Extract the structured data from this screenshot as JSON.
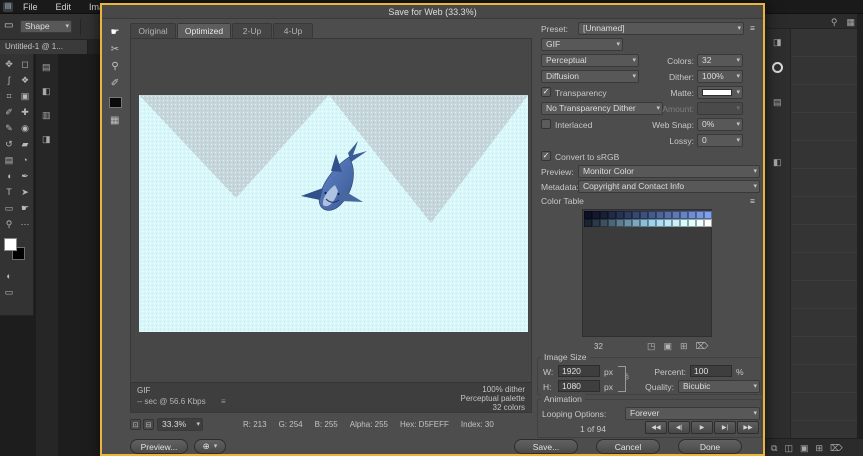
{
  "icons": {
    "chevron_down": "▾",
    "hamburger": "≡",
    "check": "✓",
    "search": "⚲",
    "grid": "▦",
    "globe": "⊕",
    "menu_small": "≡",
    "link": "§",
    "logo": "▤",
    "shape_tool": "▭"
  },
  "menu": {
    "items": [
      {
        "name": "menu-file",
        "label": "File"
      },
      {
        "name": "menu-edit",
        "label": "Edit"
      },
      {
        "name": "menu-image",
        "label": "Image"
      }
    ]
  },
  "workspace": {
    "options_bar": {
      "shape_label": "Shape"
    },
    "doc_tab": "Untitled-1 @ 1...",
    "toolbar_tools": [
      {
        "name": "move-tool",
        "glyph": "✥"
      },
      {
        "name": "marquee-tool",
        "glyph": "◻"
      },
      {
        "name": "lasso-tool",
        "glyph": "ʃ"
      },
      {
        "name": "quick-selection-tool",
        "glyph": "❖"
      },
      {
        "name": "crop-tool",
        "glyph": "⌗"
      },
      {
        "name": "frame-tool",
        "glyph": "▣"
      },
      {
        "name": "eyedropper-tool",
        "glyph": "✐"
      },
      {
        "name": "healing-brush-tool",
        "glyph": "✚"
      },
      {
        "name": "brush-tool",
        "glyph": "✎"
      },
      {
        "name": "clone-stamp-tool",
        "glyph": "◉"
      },
      {
        "name": "history-brush-tool",
        "glyph": "↺"
      },
      {
        "name": "eraser-tool",
        "glyph": "▰"
      },
      {
        "name": "gradient-tool",
        "glyph": "▤"
      },
      {
        "name": "blur-tool",
        "glyph": "◔"
      },
      {
        "name": "dodge-tool",
        "glyph": "◖"
      },
      {
        "name": "pen-tool",
        "glyph": "✒"
      },
      {
        "name": "type-tool",
        "glyph": "T"
      },
      {
        "name": "path-selection-tool",
        "glyph": "➤"
      },
      {
        "name": "rectangle-tool",
        "glyph": "▭"
      },
      {
        "name": "hand-tool",
        "glyph": "☛"
      },
      {
        "name": "zoom-tool",
        "glyph": "⚲"
      },
      {
        "name": "edit-toolbar-button",
        "glyph": "⋯"
      }
    ],
    "below_swatch_icons": [
      {
        "name": "quick-mask-icon",
        "glyph": "◐"
      },
      {
        "name": "screen-mode-icon",
        "glyph": "▭"
      }
    ],
    "left_dock_icons": [
      {
        "name": "dock-panel-icon-1",
        "glyph": "▤"
      },
      {
        "name": "dock-panel-icon-2",
        "glyph": "◧"
      },
      {
        "name": "dock-panel-icon-3",
        "glyph": "▥"
      },
      {
        "name": "dock-panel-icon-4",
        "glyph": "◨"
      }
    ],
    "right_dock": {
      "top_icons": [
        {
          "name": "search-icon",
          "glyph": "⚲"
        },
        {
          "name": "workspace-switcher-icon",
          "glyph": "▦"
        }
      ],
      "column_icons": [
        {
          "name": "panel-icon-color",
          "glyph": "◨"
        },
        {
          "name": "panel-icon-swatches",
          "glyph": "▤"
        },
        {
          "name": "panel-icon-adjustments",
          "glyph": "◧"
        }
      ],
      "bottom_icons": [
        {
          "name": "link-layers-icon",
          "glyph": "⧉"
        },
        {
          "name": "layer-style-icon",
          "glyph": "◫"
        },
        {
          "name": "add-mask-icon",
          "glyph": "▣"
        },
        {
          "name": "new-layer-icon",
          "glyph": "⊞"
        },
        {
          "name": "delete-layer-icon",
          "glyph": "⌦"
        }
      ]
    }
  },
  "dialog": {
    "title": "Save for Web (33.3%)",
    "tabs": [
      {
        "label": "Original"
      },
      {
        "label": "Optimized"
      },
      {
        "label": "2-Up"
      },
      {
        "label": "4-Up"
      }
    ],
    "side_tools": [
      {
        "name": "hand-tool",
        "glyph": "☛"
      },
      {
        "name": "slice-select-tool",
        "glyph": "✂"
      },
      {
        "name": "zoom-tool",
        "glyph": "⚲"
      },
      {
        "name": "eyedropper-tool",
        "glyph": "✐"
      }
    ],
    "preview_meta": {
      "format": "GIF",
      "rate": "-- sec @ 56.6 Kbps",
      "dither": "100% dither",
      "palette": "Perceptual palette",
      "colors": "32 colors"
    },
    "status": {
      "zoom": "33.3%",
      "buttons": [
        {
          "name": "preview-option-button-1",
          "glyph": "⊡"
        },
        {
          "name": "preview-option-button-2",
          "glyph": "⊟"
        }
      ],
      "readouts": [
        {
          "name": "status-r",
          "label": "R: 213",
          "interactable": false
        },
        {
          "name": "status-g",
          "label": "G: 254",
          "interactable": false
        },
        {
          "name": "status-b",
          "label": "B: 255",
          "interactable": false
        },
        {
          "name": "status-alpha",
          "label": "Alpha: 255",
          "interactable": false
        },
        {
          "name": "status-hex",
          "label": "Hex: D5FEFF",
          "interactable": false
        },
        {
          "name": "status-index",
          "label": "Index: 30",
          "interactable": false
        }
      ]
    },
    "settings": {
      "preset_label": "Preset:",
      "preset": "[Unnamed]",
      "format": "GIF",
      "palette": "Perceptual",
      "colors_label": "Colors:",
      "colors": "32",
      "dither_method": "Diffusion",
      "dither_label": "Dither:",
      "dither": "100%",
      "transparency_label": "Transparency",
      "matte_label": "Matte:",
      "transparency_dither": "No Transparency Dither",
      "amount_label": "Amount:",
      "interlaced_label": "Interlaced",
      "web_snap_label": "Web Snap:",
      "web_snap": "0%",
      "lossy_label": "Lossy:",
      "lossy": "0",
      "srgb_label": "Convert to sRGB",
      "preview_label": "Preview:",
      "preview": "Monitor Color",
      "metadata_label": "Metadata:",
      "metadata": "Copyright and Contact Info"
    },
    "color_table": {
      "title": "Color Table",
      "count": "32",
      "colors": [
        "#0b1026",
        "#11182f",
        "#182038",
        "#1f2a46",
        "#263354",
        "#2e3d62",
        "#364770",
        "#3e517e",
        "#465b8c",
        "#4e659a",
        "#566fa8",
        "#5e79b6",
        "#6683c4",
        "#6e8dd2",
        "#7697e0",
        "#7ea1ee",
        "#1c2430",
        "#2c3a48",
        "#3c5060",
        "#4c6678",
        "#5c7c90",
        "#6c92a8",
        "#7ca8c0",
        "#8cbed8",
        "#9cd4f0",
        "#acdff4",
        "#bce8f7",
        "#cceffa",
        "#d5feff",
        "#e2ffff",
        "#f0ffff",
        "#ffffff"
      ],
      "footer_icons": [
        {
          "name": "snap-web-palette-icon",
          "glyph": "◳"
        },
        {
          "name": "lock-color-icon",
          "glyph": "▣"
        },
        {
          "name": "add-color-icon",
          "glyph": "⊞"
        },
        {
          "name": "delete-color-icon",
          "glyph": "⌦"
        }
      ]
    },
    "image_size": {
      "title": "Image Size",
      "w_label": "W:",
      "w": "1920",
      "h_label": "H:",
      "h": "1080",
      "px": "px",
      "percent_label": "Percent:",
      "percent": "100",
      "percent_unit": "%",
      "quality_label": "Quality:",
      "quality": "Bicubic"
    },
    "animation": {
      "title": "Animation",
      "looping_label": "Looping Options:",
      "looping": "Forever",
      "frame": "1 of 94",
      "controls": [
        {
          "name": "first-frame-button",
          "glyph": "◀◀"
        },
        {
          "name": "prev-frame-button",
          "glyph": "◀|"
        },
        {
          "name": "play-button",
          "glyph": "▶"
        },
        {
          "name": "next-frame-button",
          "glyph": "▶|"
        },
        {
          "name": "last-frame-button",
          "glyph": "▶▶"
        }
      ]
    },
    "buttons": {
      "preview": "Preview...",
      "save": "Save...",
      "cancel": "Cancel",
      "done": "Done"
    }
  }
}
